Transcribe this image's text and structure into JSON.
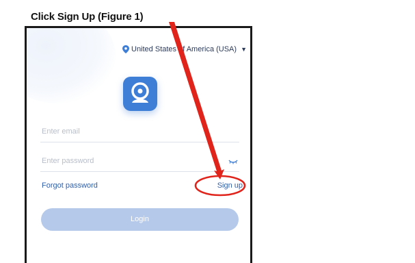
{
  "caption": "Click Sign Up (Figure 1)",
  "header": {
    "region_label": "United States of America (USA)",
    "region_caret": "▼"
  },
  "app_logo_icon": "camera-icon",
  "form": {
    "email_placeholder": "Enter email",
    "password_placeholder": "Enter password",
    "forgot_label": "Forgot password",
    "signup_label": "Sign up",
    "login_label": "Login"
  },
  "colors": {
    "accent": "#3f7ed6",
    "link": "#2f5ea8",
    "login_disabled": "#b5c9ea",
    "annotation_red": "#e0241c"
  }
}
